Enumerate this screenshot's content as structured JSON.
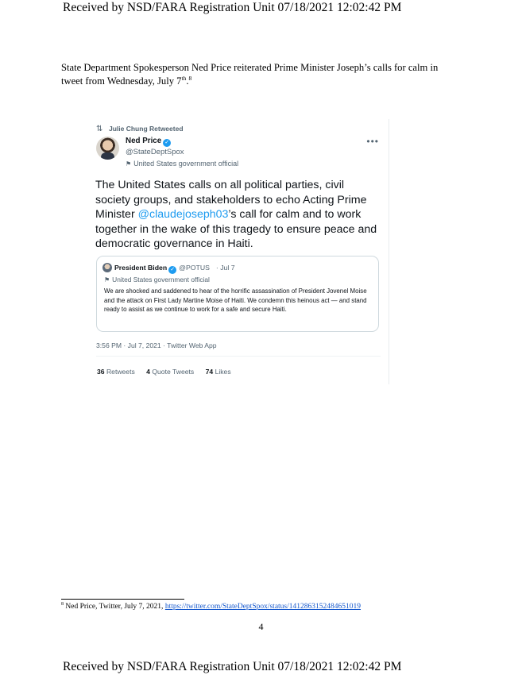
{
  "stamp": "Received by NSD/FARA Registration Unit   07/18/2021  12:02:42 PM",
  "paragraph": {
    "text_a": "State Department Spokesperson Ned Price reiterated Prime Minister Joseph’s calls for calm in tweet from Wednesday, July 7",
    "ordinal": "th",
    "text_b": ".",
    "footnote_ref": "8"
  },
  "tweet": {
    "retweet_label": "Julie Chung Retweeted",
    "author_name": "Ned Price",
    "author_handle": "@StateDeptSpox",
    "author_label": "United States government official",
    "body_a": "The United States calls on all political parties, civil society groups, and stakeholders to echo Acting Prime Minister ",
    "body_mention": "@claudejoseph03",
    "body_b": "’s call for calm and to work together in the wake of this tragedy to ensure peace and democratic governance in Haiti.",
    "quote": {
      "name": "President Biden",
      "handle": "@POTUS",
      "date": "· Jul 7",
      "label": "United States government official",
      "text": "We are shocked and saddened to hear of the horrific assassination of President Jovenel Moise and the attack on First Lady Martine Moise of Haiti. We condemn this heinous act — and stand ready to assist as we continue to work for a safe and secure Haiti."
    },
    "timestamp": "3:56 PM · Jul 7, 2021 · Twitter Web App",
    "stats": {
      "retweets_count": "36",
      "retweets_label": "Retweets",
      "quotes_count": "4",
      "quotes_label": "Quote Tweets",
      "likes_count": "74",
      "likes_label": "Likes"
    },
    "icons": [
      "retweet-icon",
      "verified-badge-icon",
      "flag-icon",
      "more-options-icon"
    ]
  },
  "footnote": {
    "number": "8",
    "text": " Ned Price, Twitter, July 7, 2021, ",
    "link": "https://twitter.com/StateDeptSpox/status/1412863152484651019"
  },
  "page_number": "4"
}
